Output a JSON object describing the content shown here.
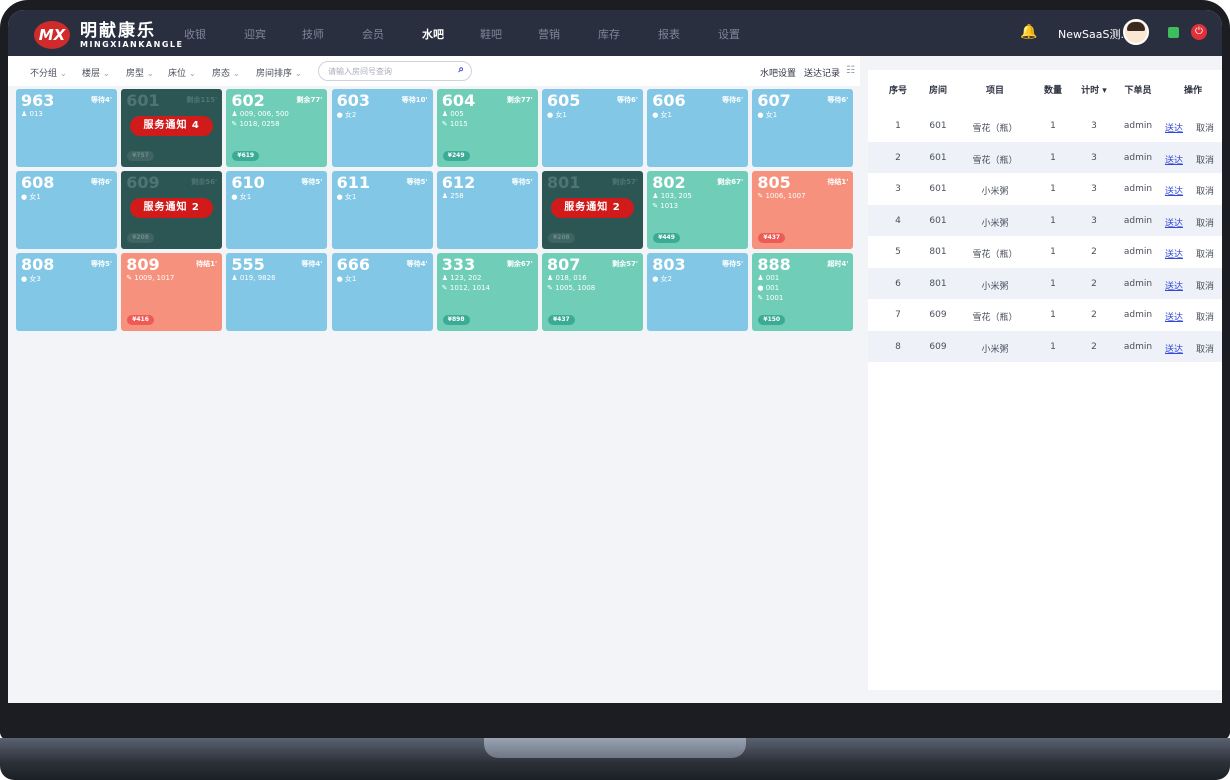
{
  "brand": {
    "badge": "MX",
    "name_cn": "明献康乐",
    "name_en": "MINGXIANKANGLE"
  },
  "nav": [
    "收银",
    "迎宾",
    "技师",
    "会员",
    "水吧",
    "鞋吧",
    "营销",
    "库存",
    "报表",
    "设置"
  ],
  "nav_active": "水吧",
  "user": {
    "name": "NewSaaS测..."
  },
  "filters": [
    "不分组",
    "楼层",
    "房型",
    "床位",
    "房态",
    "房间排序"
  ],
  "search": {
    "placeholder": "请输入房间号查询"
  },
  "links": {
    "settings": "水吧设置",
    "records": "送达记录"
  },
  "rooms": [
    {
      "num": "963",
      "status": "等待4'",
      "color": "blue",
      "lines": [
        "♟ 013"
      ],
      "price": ""
    },
    {
      "num": "601",
      "status": "剩余115'",
      "color": "dark",
      "lines": [],
      "price": "¥757",
      "notice": "服务通知 4"
    },
    {
      "num": "602",
      "status": "剩余77'",
      "color": "teal",
      "lines": [
        "♟ 009, 006, 500",
        "✎ 1018, 0258"
      ],
      "price": "¥619"
    },
    {
      "num": "603",
      "status": "等待10'",
      "color": "blue",
      "lines": [
        "● 女2"
      ],
      "price": ""
    },
    {
      "num": "604",
      "status": "剩余77'",
      "color": "teal",
      "lines": [
        "♟ 005",
        "✎ 1015"
      ],
      "price": "¥249"
    },
    {
      "num": "605",
      "status": "等待6'",
      "color": "blue",
      "lines": [
        "● 女1"
      ],
      "price": ""
    },
    {
      "num": "606",
      "status": "等待6'",
      "color": "blue",
      "lines": [
        "● 女1"
      ],
      "price": ""
    },
    {
      "num": "607",
      "status": "等待6'",
      "color": "blue",
      "lines": [
        "● 女1"
      ],
      "price": ""
    },
    {
      "num": "608",
      "status": "等待6'",
      "color": "blue",
      "lines": [
        "● 女1"
      ],
      "price": ""
    },
    {
      "num": "609",
      "status": "剩余56'",
      "color": "dark",
      "lines": [],
      "price": "¥208",
      "notice": "服务通知 2"
    },
    {
      "num": "610",
      "status": "等待5'",
      "color": "blue",
      "lines": [
        "● 女1"
      ],
      "price": ""
    },
    {
      "num": "611",
      "status": "等待5'",
      "color": "blue",
      "lines": [
        "● 女1"
      ],
      "price": ""
    },
    {
      "num": "612",
      "status": "等待5'",
      "color": "blue",
      "lines": [
        "♟ 258"
      ],
      "price": ""
    },
    {
      "num": "801",
      "status": "剩余57'",
      "color": "dark",
      "lines": [],
      "price": "¥208",
      "notice": "服务通知 2"
    },
    {
      "num": "802",
      "status": "剩余67'",
      "color": "teal",
      "lines": [
        "♟ 103, 205",
        "✎ 1013"
      ],
      "price": "¥449"
    },
    {
      "num": "805",
      "status": "待结1'",
      "color": "red",
      "lines": [
        "✎ 1006, 1007"
      ],
      "price": "¥437"
    },
    {
      "num": "808",
      "status": "等待5'",
      "color": "blue",
      "lines": [
        "● 女3"
      ],
      "price": ""
    },
    {
      "num": "809",
      "status": "待结1'",
      "color": "red",
      "lines": [
        "✎ 1009, 1017"
      ],
      "price": "¥416"
    },
    {
      "num": "555",
      "status": "等待4'",
      "color": "blue",
      "lines": [
        "♟ 019, 9826"
      ],
      "price": ""
    },
    {
      "num": "666",
      "status": "等待4'",
      "color": "blue",
      "lines": [
        "● 女1"
      ],
      "price": ""
    },
    {
      "num": "333",
      "status": "剩余67'",
      "color": "teal",
      "lines": [
        "♟ 123, 202",
        "✎ 1012, 1014"
      ],
      "price": "¥898"
    },
    {
      "num": "807",
      "status": "剩余57'",
      "color": "teal",
      "lines": [
        "♟ 018, 016",
        "✎ 1005, 1008"
      ],
      "price": "¥437"
    },
    {
      "num": "803",
      "status": "等待5'",
      "color": "blue",
      "lines": [
        "● 女2"
      ],
      "price": ""
    },
    {
      "num": "888",
      "status": "超时4'",
      "color": "teal",
      "lines": [
        "♟ 001",
        "● 001",
        "✎ 1001"
      ],
      "price": "¥150"
    }
  ],
  "table": {
    "headers": [
      "序号",
      "房间",
      "项目",
      "数量",
      "计时 ▾",
      "下单员",
      "操作"
    ],
    "rows": [
      {
        "idx": "1",
        "room": "601",
        "item": "雪花（瓶）",
        "qty": "1",
        "timer": "3",
        "staff": "admin",
        "deliver": "送达",
        "cancel": "取消"
      },
      {
        "idx": "2",
        "room": "601",
        "item": "雪花（瓶）",
        "qty": "1",
        "timer": "3",
        "staff": "admin",
        "deliver": "送达",
        "cancel": "取消"
      },
      {
        "idx": "3",
        "room": "601",
        "item": "小米粥",
        "qty": "1",
        "timer": "3",
        "staff": "admin",
        "deliver": "送达",
        "cancel": "取消"
      },
      {
        "idx": "4",
        "room": "601",
        "item": "小米粥",
        "qty": "1",
        "timer": "3",
        "staff": "admin",
        "deliver": "送达",
        "cancel": "取消"
      },
      {
        "idx": "5",
        "room": "801",
        "item": "雪花（瓶）",
        "qty": "1",
        "timer": "2",
        "staff": "admin",
        "deliver": "送达",
        "cancel": "取消"
      },
      {
        "idx": "6",
        "room": "801",
        "item": "小米粥",
        "qty": "1",
        "timer": "2",
        "staff": "admin",
        "deliver": "送达",
        "cancel": "取消"
      },
      {
        "idx": "7",
        "room": "609",
        "item": "雪花（瓶）",
        "qty": "1",
        "timer": "2",
        "staff": "admin",
        "deliver": "送达",
        "cancel": "取消"
      },
      {
        "idx": "8",
        "room": "609",
        "item": "小米粥",
        "qty": "1",
        "timer": "2",
        "staff": "admin",
        "deliver": "送达",
        "cancel": "取消"
      }
    ]
  },
  "colors": {
    "blue": "#82c7e6",
    "teal": "#6fcdb8",
    "dark": "#2c5654",
    "red": "#f5917d",
    "nav_bg": "#2a2f3f",
    "link": "#3249d6"
  }
}
